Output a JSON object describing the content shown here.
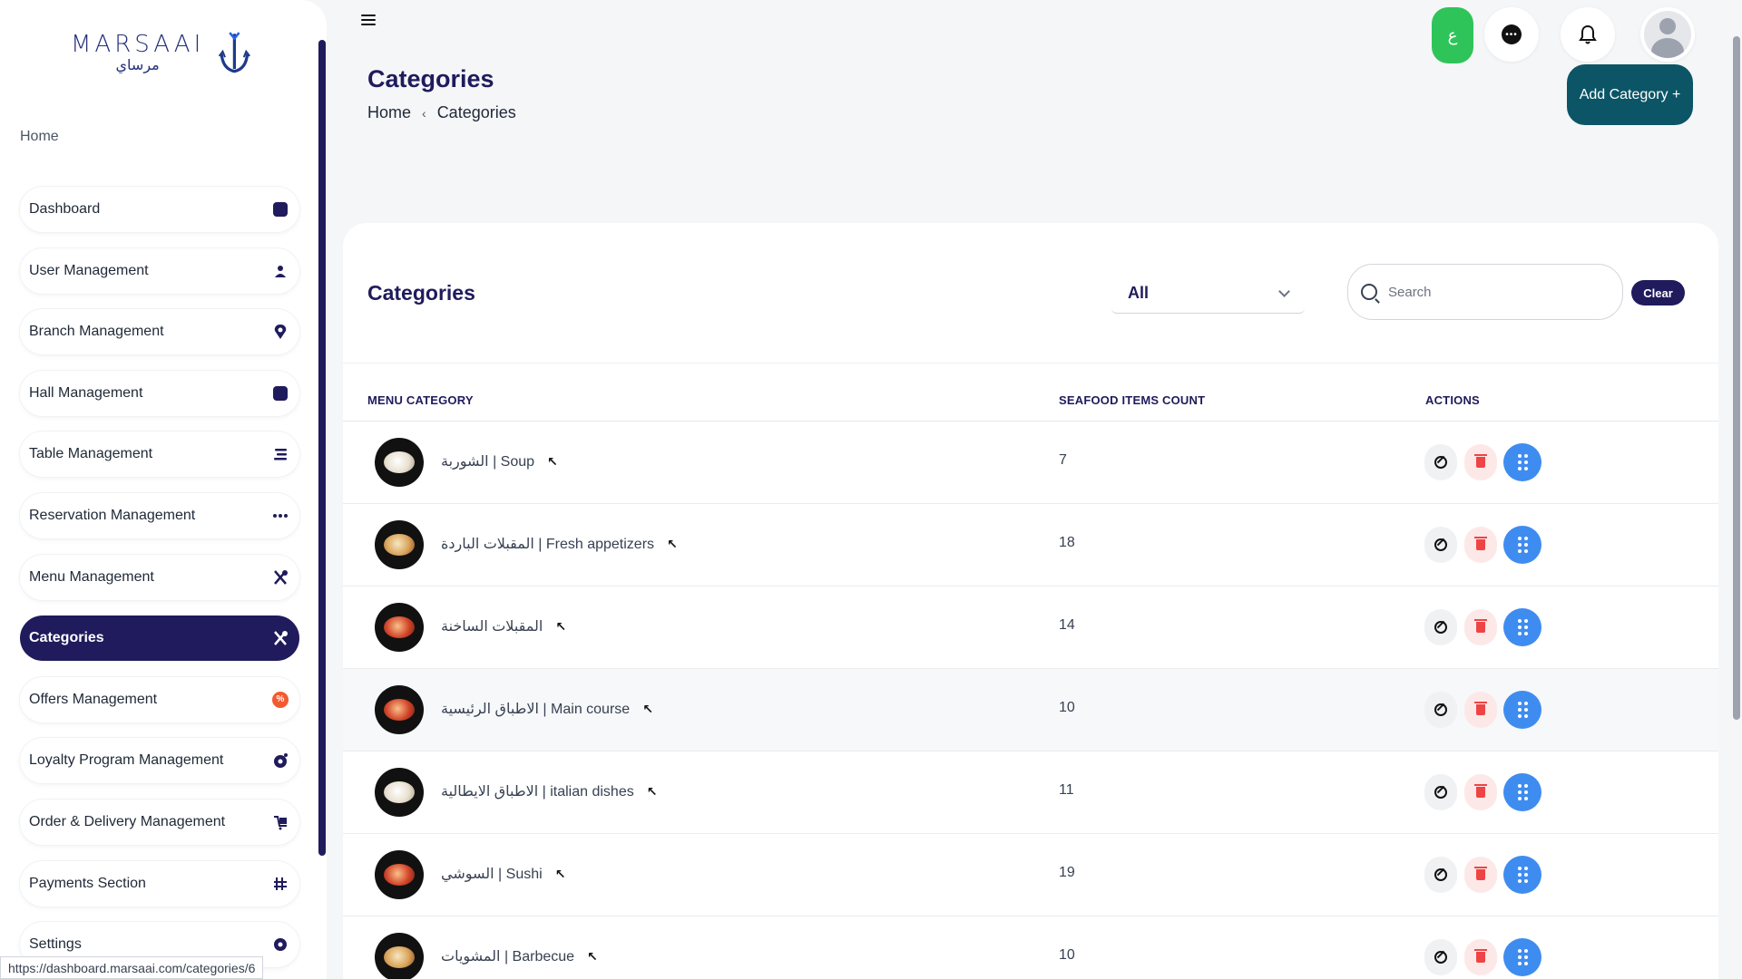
{
  "brand": {
    "name_en": "MARSAAI",
    "name_ar": "مرساي"
  },
  "sidebar": {
    "home_label": "Home",
    "items": [
      {
        "label": "Dashboard",
        "icon": "dashboard-icon"
      },
      {
        "label": "User Management",
        "icon": "user-icon"
      },
      {
        "label": "Branch Management",
        "icon": "location-pin-icon"
      },
      {
        "label": "Hall Management",
        "icon": "hall-icon"
      },
      {
        "label": "Table Management",
        "icon": "table-icon"
      },
      {
        "label": "Reservation Management",
        "icon": "more-dots-icon"
      },
      {
        "label": "Menu Management",
        "icon": "utensils-icon"
      },
      {
        "label": "Categories",
        "icon": "utensils-icon",
        "active": true
      },
      {
        "label": "Offers Management",
        "icon": "percent-icon"
      },
      {
        "label": "Loyalty Program Management",
        "icon": "loyalty-icon"
      },
      {
        "label": "Order & Delivery Management",
        "icon": "delivery-icon"
      },
      {
        "label": "Payments Section",
        "icon": "payments-icon"
      },
      {
        "label": "Settings",
        "icon": "settings-icon"
      }
    ]
  },
  "status_url": "https://dashboard.marsaai.com/categories/6",
  "topbar": {
    "lang_label": "ع",
    "chat_icon": "chat-icon",
    "bell_icon": "bell-icon",
    "avatar_icon": "avatar-icon"
  },
  "page": {
    "title": "Categories",
    "breadcrumb": [
      "Home",
      "Categories"
    ],
    "breadcrumb_sep": "‹",
    "add_button": "Add Category +"
  },
  "card": {
    "title": "Categories",
    "filter_value": "All",
    "search_placeholder": "Search",
    "clear_label": "Clear",
    "columns": [
      "MENU CATEGORY",
      "SEAFOOD ITEMS COUNT",
      "ACTIONS"
    ],
    "rows": [
      {
        "name": "الشوربة | Soup",
        "count": "7"
      },
      {
        "name": "المقبلات الباردة | Fresh appetizers",
        "count": "18"
      },
      {
        "name": "المقبلات الساخنة",
        "count": "14"
      },
      {
        "name": "الاطباق الرئيسية | Main course",
        "count": "10"
      },
      {
        "name": "الاطباق الايطالية | italian dishes",
        "count": "11"
      },
      {
        "name": "السوشي | Sushi",
        "count": "19"
      },
      {
        "name": "المشويات | Barbecue",
        "count": "10"
      }
    ]
  },
  "colors": {
    "primary": "#1f1b5c",
    "teal": "#0b5566",
    "green": "#2fc45a",
    "blue_action": "#3f8cf0",
    "red_action": "#ef4444"
  }
}
